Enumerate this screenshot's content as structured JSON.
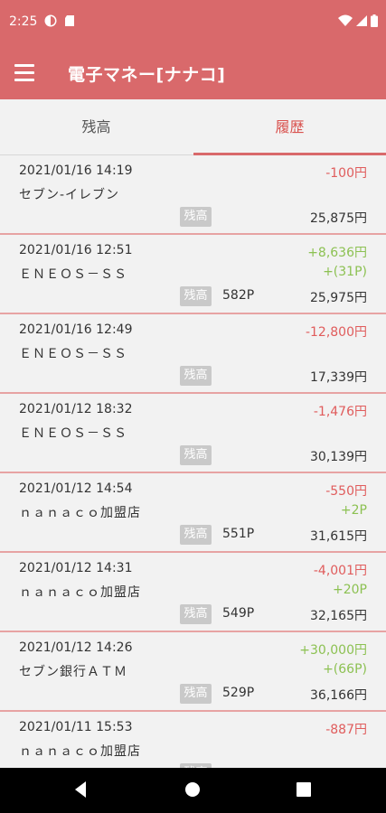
{
  "status": {
    "time": "2:25"
  },
  "app": {
    "title": "電子マネー[ナナコ]"
  },
  "tabs": [
    {
      "label": "残高"
    },
    {
      "label": "履歴"
    }
  ],
  "badge_label": "残高",
  "colors": {
    "header": "#d9696b",
    "negative": "#e05c5c",
    "positive": "#8cc152",
    "divider": "#e7a3a3"
  },
  "transactions": [
    {
      "datetime": "2021/01/16 14:19",
      "store": "セブン-イレブン",
      "amount": "-100円",
      "points": "",
      "bonus": "",
      "balance": "25,875円"
    },
    {
      "datetime": "2021/01/16 12:51",
      "store": "ＥＮＥＯＳ－ＳＳ",
      "amount": "+8,636円",
      "points": "+(31P)",
      "bonus": "582P",
      "balance": "25,975円"
    },
    {
      "datetime": "2021/01/16 12:49",
      "store": "ＥＮＥＯＳ－ＳＳ",
      "amount": "-12,800円",
      "points": "",
      "bonus": "",
      "balance": "17,339円"
    },
    {
      "datetime": "2021/01/12 18:32",
      "store": "ＥＮＥＯＳ－ＳＳ",
      "amount": "-1,476円",
      "points": "",
      "bonus": "",
      "balance": "30,139円"
    },
    {
      "datetime": "2021/01/12 14:54",
      "store": "ｎａｎａｃｏ加盟店",
      "amount": "-550円",
      "points": "+2P",
      "bonus": "551P",
      "balance": "31,615円"
    },
    {
      "datetime": "2021/01/12 14:31",
      "store": "ｎａｎａｃｏ加盟店",
      "amount": "-4,001円",
      "points": "+20P",
      "bonus": "549P",
      "balance": "32,165円"
    },
    {
      "datetime": "2021/01/12 14:26",
      "store": "セブン銀行ＡＴＭ",
      "amount": "+30,000円",
      "points": "+(66P)",
      "bonus": "529P",
      "balance": "36,166円"
    },
    {
      "datetime": "2021/01/11 15:53",
      "store": "ｎａｎａｃｏ加盟店",
      "amount": "-887円",
      "points": "",
      "bonus": "",
      "balance": ""
    }
  ]
}
